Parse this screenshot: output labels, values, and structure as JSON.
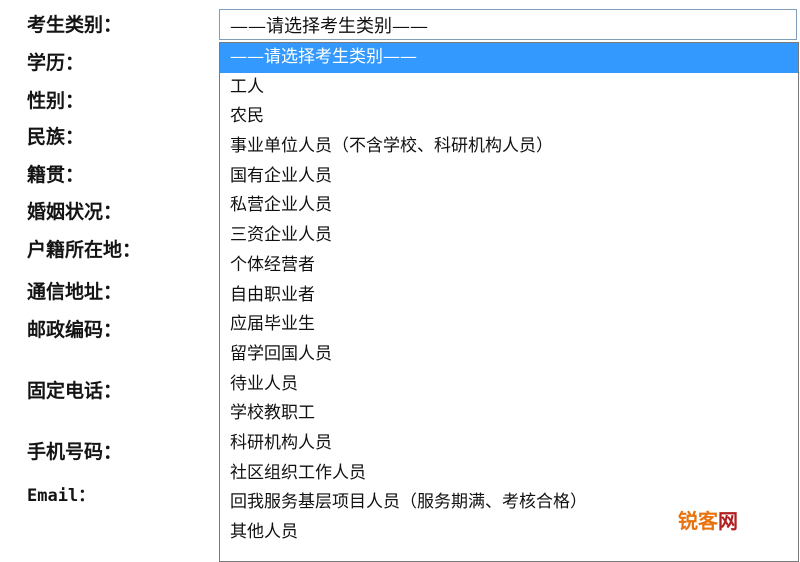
{
  "form": {
    "labels": [
      "考生类别：",
      "学历：",
      "性别：",
      "民族：",
      "籍贯：",
      "婚姻状况：",
      "户籍所在地：",
      "通信地址：",
      "邮政编码：",
      "固定电话：",
      "手机号码：",
      "Email："
    ]
  },
  "category_select": {
    "value": "——请选择考生类别——",
    "options": [
      "——请选择考生类别——",
      "工人",
      "农民",
      "事业单位人员（不含学校、科研机构人员）",
      "国有企业人员",
      "私营企业人员",
      "三资企业人员",
      "个体经营者",
      "自由职业者",
      "应届毕业生",
      "留学回国人员",
      "待业人员",
      "学校教职工",
      "科研机构人员",
      "社区组织工作人员",
      "回我服务基层项目人员（服务期满、考核合格）",
      "其他人员"
    ],
    "highlighted_index": 0,
    "highlight_color": "#3399ff"
  },
  "watermark": {
    "part1": "锐客",
    "part2": "网"
  }
}
